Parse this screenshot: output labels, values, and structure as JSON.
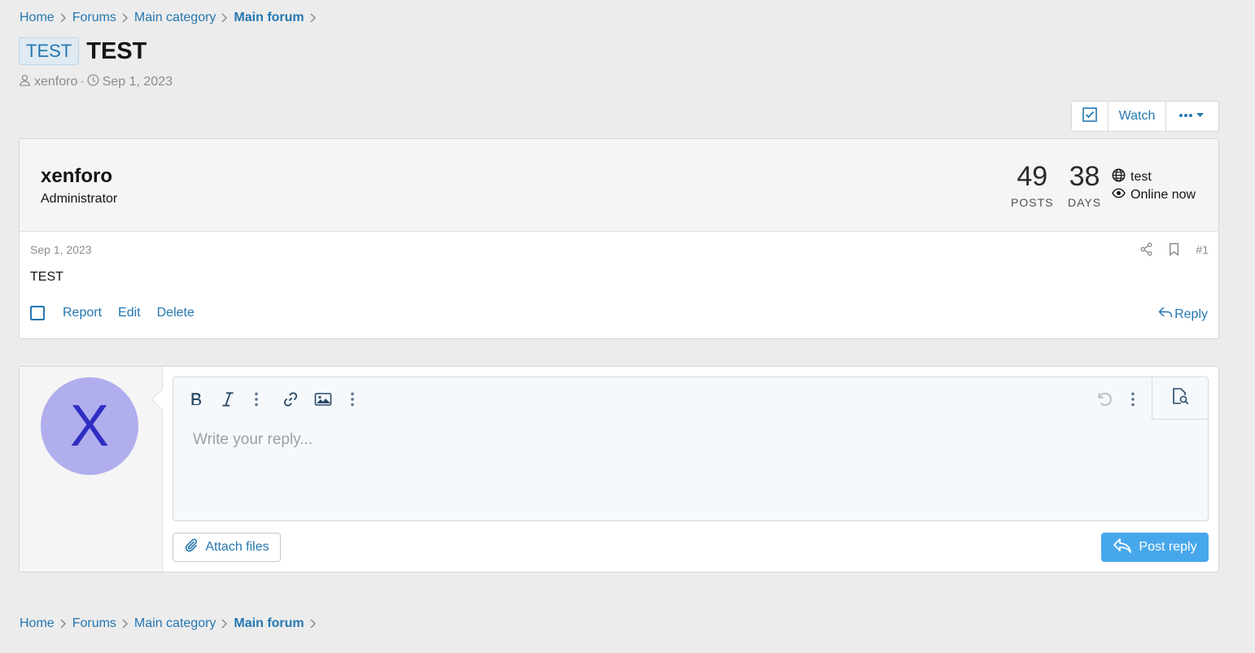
{
  "breadcrumb": [
    {
      "label": "Home"
    },
    {
      "label": "Forums"
    },
    {
      "label": "Main category"
    },
    {
      "label": "Main forum"
    }
  ],
  "thread": {
    "prefix": "TEST",
    "title": "TEST",
    "author": "xenforo",
    "date": "Sep 1, 2023",
    "meta_separator": "·"
  },
  "thread_actions": {
    "watch_label": "Watch"
  },
  "post": {
    "username": "xenforo",
    "user_title": "Administrator",
    "posts_count": "49",
    "posts_label": "POSTS",
    "days_count": "38",
    "days_label": "DAYS",
    "location": "test",
    "status": "Online now",
    "date": "Sep 1, 2023",
    "number": "#1",
    "body": "TEST",
    "actions": {
      "report": "Report",
      "edit": "Edit",
      "delete": "Delete",
      "reply": "Reply"
    }
  },
  "quick_reply": {
    "avatar_letter": "X",
    "placeholder": "Write your reply...",
    "attach_label": "Attach files",
    "post_label": "Post reply"
  },
  "colors": {
    "link": "#2577b1",
    "background": "#ececec",
    "avatar_bg": "#b0aeec",
    "avatar_fg": "#2f2dc3",
    "primary_button": "#47a7eb"
  }
}
